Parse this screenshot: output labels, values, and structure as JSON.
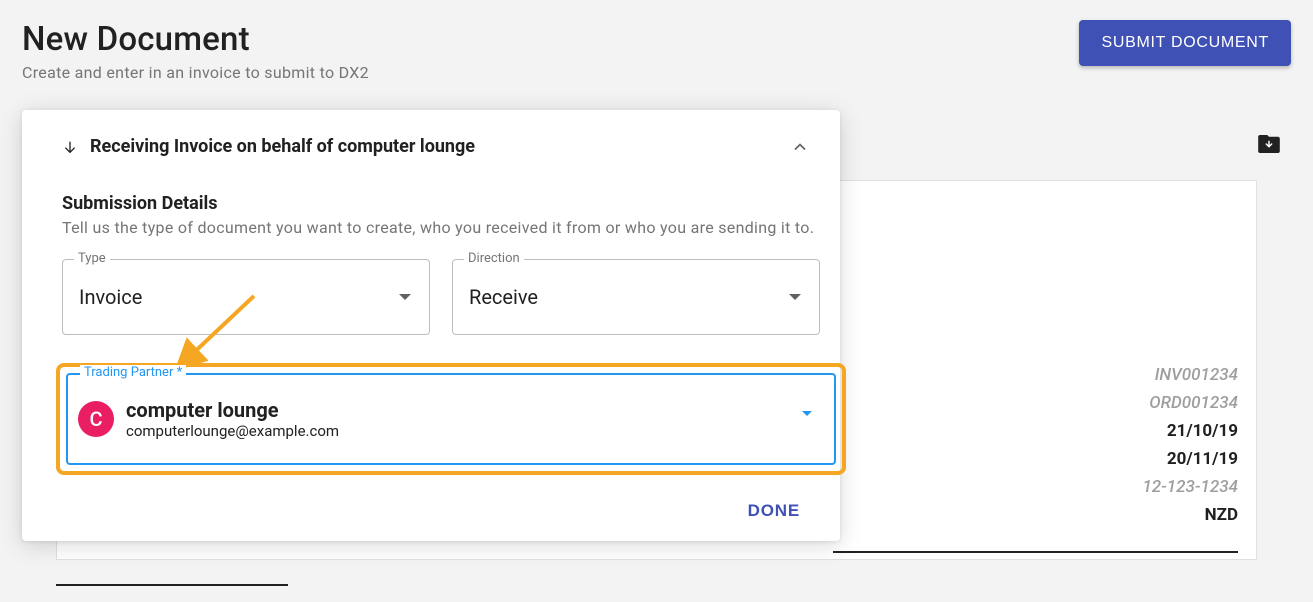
{
  "header": {
    "title": "New Document",
    "subtitle": "Create and enter in an invoice to submit to DX2",
    "submit_label": "SUBMIT DOCUMENT"
  },
  "panel": {
    "header_title": "Receiving Invoice on behalf of computer lounge",
    "section_title": "Submission Details",
    "section_desc": "Tell us the type of document you want to create, who you received it from or who you are sending it to.",
    "type": {
      "label": "Type",
      "value": "Invoice"
    },
    "direction": {
      "label": "Direction",
      "value": "Receive"
    },
    "partner": {
      "label": "Trading Partner *",
      "initial": "C",
      "name": "computer lounge",
      "email": "computerlounge@example.com"
    },
    "done_label": "DONE"
  },
  "invoice_values": {
    "invoice_no": "INV001234",
    "order_no": "ORD001234",
    "date1": "21/10/19",
    "date2": "20/11/19",
    "phone": "12-123-1234",
    "currency": "NZD"
  }
}
